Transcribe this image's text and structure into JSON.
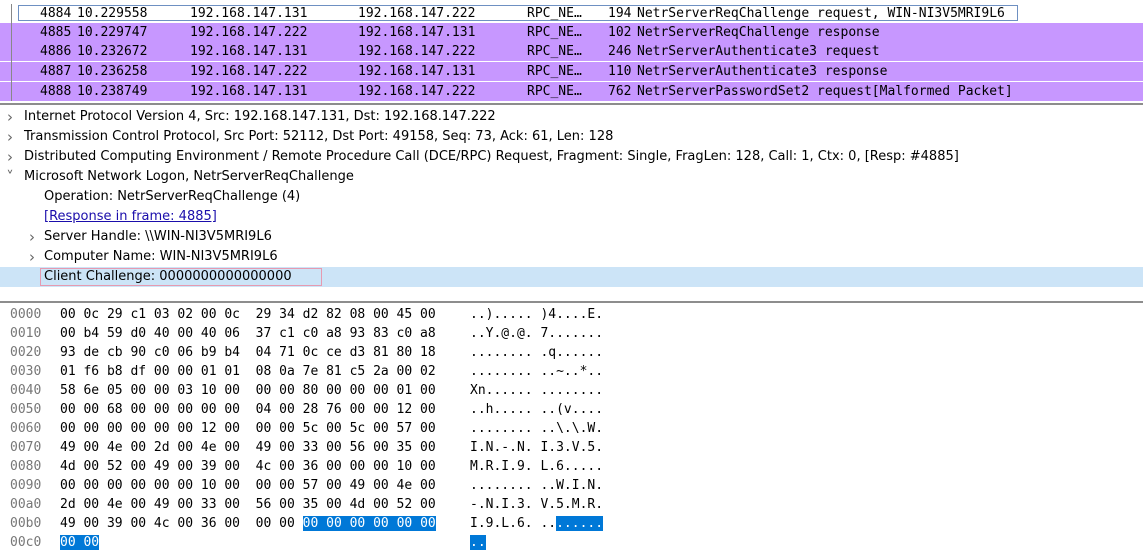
{
  "packets": [
    {
      "no": "4884",
      "time": "10.229558",
      "src": "192.168.147.131",
      "dst": "192.168.147.222",
      "proto": "RPC_NE…",
      "len": "194",
      "info": "NetrServerReqChallenge request, WIN-NI3V5MRI9L6",
      "style": "selected"
    },
    {
      "no": "4885",
      "time": "10.229747",
      "src": "192.168.147.222",
      "dst": "192.168.147.131",
      "proto": "RPC_NE…",
      "len": "102",
      "info": "NetrServerReqChallenge response",
      "style": "purple"
    },
    {
      "no": "4886",
      "time": "10.232672",
      "src": "192.168.147.131",
      "dst": "192.168.147.222",
      "proto": "RPC_NE…",
      "len": "246",
      "info": "NetrServerAuthenticate3 request",
      "style": "purple"
    },
    {
      "no": "4887",
      "time": "10.236258",
      "src": "192.168.147.222",
      "dst": "192.168.147.131",
      "proto": "RPC_NE…",
      "len": "110",
      "info": "NetrServerAuthenticate3 response",
      "style": "purple"
    },
    {
      "no": "4888",
      "time": "10.238749",
      "src": "192.168.147.131",
      "dst": "192.168.147.222",
      "proto": "RPC_NE…",
      "len": "762",
      "info": "NetrServerPasswordSet2 request[Malformed Packet]",
      "style": "purple"
    }
  ],
  "details": [
    {
      "indent": 0,
      "arrow": "collapsed",
      "text": "Internet Protocol Version 4, Src: 192.168.147.131, Dst: 192.168.147.222"
    },
    {
      "indent": 0,
      "arrow": "collapsed",
      "text": "Transmission Control Protocol, Src Port: 52112, Dst Port: 49158, Seq: 73, Ack: 61, Len: 128"
    },
    {
      "indent": 0,
      "arrow": "collapsed",
      "text": "Distributed Computing Environment / Remote Procedure Call (DCE/RPC) Request, Fragment: Single, FragLen: 128, Call: 1, Ctx: 0, [Resp: #4885]"
    },
    {
      "indent": 0,
      "arrow": "expanded",
      "text": "Microsoft Network Logon, NetrServerReqChallenge"
    },
    {
      "indent": 1,
      "arrow": "none",
      "text": "Operation: NetrServerReqChallenge (4)"
    },
    {
      "indent": 1,
      "arrow": "none",
      "text": "[Response in frame: 4885]",
      "link": true
    },
    {
      "indent": 1,
      "arrow": "collapsed",
      "text": "Server Handle: \\\\WIN-NI3V5MRI9L6"
    },
    {
      "indent": 1,
      "arrow": "collapsed",
      "text": "Computer Name: WIN-NI3V5MRI9L6"
    },
    {
      "indent": 1,
      "arrow": "none",
      "text": "Client Challenge: 0000000000000000",
      "highlight": true
    }
  ],
  "bytes": [
    {
      "offset": "0000",
      "hex": [
        "00",
        "0c",
        "29",
        "c1",
        "03",
        "02",
        "00",
        "0c",
        "29",
        "34",
        "d2",
        "82",
        "08",
        "00",
        "45",
        "00"
      ],
      "ascii": "..)..... )4....E."
    },
    {
      "offset": "0010",
      "hex": [
        "00",
        "b4",
        "59",
        "d0",
        "40",
        "00",
        "40",
        "06",
        "37",
        "c1",
        "c0",
        "a8",
        "93",
        "83",
        "c0",
        "a8"
      ],
      "ascii": "..Y.@.@. 7......."
    },
    {
      "offset": "0020",
      "hex": [
        "93",
        "de",
        "cb",
        "90",
        "c0",
        "06",
        "b9",
        "b4",
        "04",
        "71",
        "0c",
        "ce",
        "d3",
        "81",
        "80",
        "18"
      ],
      "ascii": "........ .q......"
    },
    {
      "offset": "0030",
      "hex": [
        "01",
        "f6",
        "b8",
        "df",
        "00",
        "00",
        "01",
        "01",
        "08",
        "0a",
        "7e",
        "81",
        "c5",
        "2a",
        "00",
        "02"
      ],
      "ascii": "........ ..~..*.."
    },
    {
      "offset": "0040",
      "hex": [
        "58",
        "6e",
        "05",
        "00",
        "00",
        "03",
        "10",
        "00",
        "00",
        "00",
        "80",
        "00",
        "00",
        "00",
        "01",
        "00"
      ],
      "ascii": "Xn...... ........"
    },
    {
      "offset": "0050",
      "hex": [
        "00",
        "00",
        "68",
        "00",
        "00",
        "00",
        "00",
        "00",
        "04",
        "00",
        "28",
        "76",
        "00",
        "00",
        "12",
        "00"
      ],
      "ascii": "..h..... ..(v...."
    },
    {
      "offset": "0060",
      "hex": [
        "00",
        "00",
        "00",
        "00",
        "00",
        "00",
        "12",
        "00",
        "00",
        "00",
        "5c",
        "00",
        "5c",
        "00",
        "57",
        "00"
      ],
      "ascii": "........ ..\\.\\.W."
    },
    {
      "offset": "0070",
      "hex": [
        "49",
        "00",
        "4e",
        "00",
        "2d",
        "00",
        "4e",
        "00",
        "49",
        "00",
        "33",
        "00",
        "56",
        "00",
        "35",
        "00"
      ],
      "ascii": "I.N.-.N. I.3.V.5."
    },
    {
      "offset": "0080",
      "hex": [
        "4d",
        "00",
        "52",
        "00",
        "49",
        "00",
        "39",
        "00",
        "4c",
        "00",
        "36",
        "00",
        "00",
        "00",
        "10",
        "00"
      ],
      "ascii": "M.R.I.9. L.6....."
    },
    {
      "offset": "0090",
      "hex": [
        "00",
        "00",
        "00",
        "00",
        "00",
        "00",
        "10",
        "00",
        "00",
        "00",
        "57",
        "00",
        "49",
        "00",
        "4e",
        "00"
      ],
      "ascii": "........ ..W.I.N."
    },
    {
      "offset": "00a0",
      "hex": [
        "2d",
        "00",
        "4e",
        "00",
        "49",
        "00",
        "33",
        "00",
        "56",
        "00",
        "35",
        "00",
        "4d",
        "00",
        "52",
        "00"
      ],
      "ascii": "-.N.I.3. V.5.M.R."
    },
    {
      "offset": "00b0",
      "hex": [
        "49",
        "00",
        "39",
        "00",
        "4c",
        "00",
        "36",
        "00",
        "00",
        "00",
        "00",
        "00",
        "00",
        "00",
        "00",
        "00"
      ],
      "ascii": "I.9.L.6. ........",
      "sel_from": 10
    },
    {
      "offset": "00c0",
      "hex": [
        "00",
        "00"
      ],
      "ascii": "..",
      "sel_from": 0
    }
  ],
  "colors": {
    "purple_row": "#c797ff",
    "selected_detail": "#cce4f7",
    "selected_bytes": "#0078d7"
  },
  "icons": {
    "collapsed": "chevron-right-icon",
    "expanded": "chevron-down-icon"
  }
}
